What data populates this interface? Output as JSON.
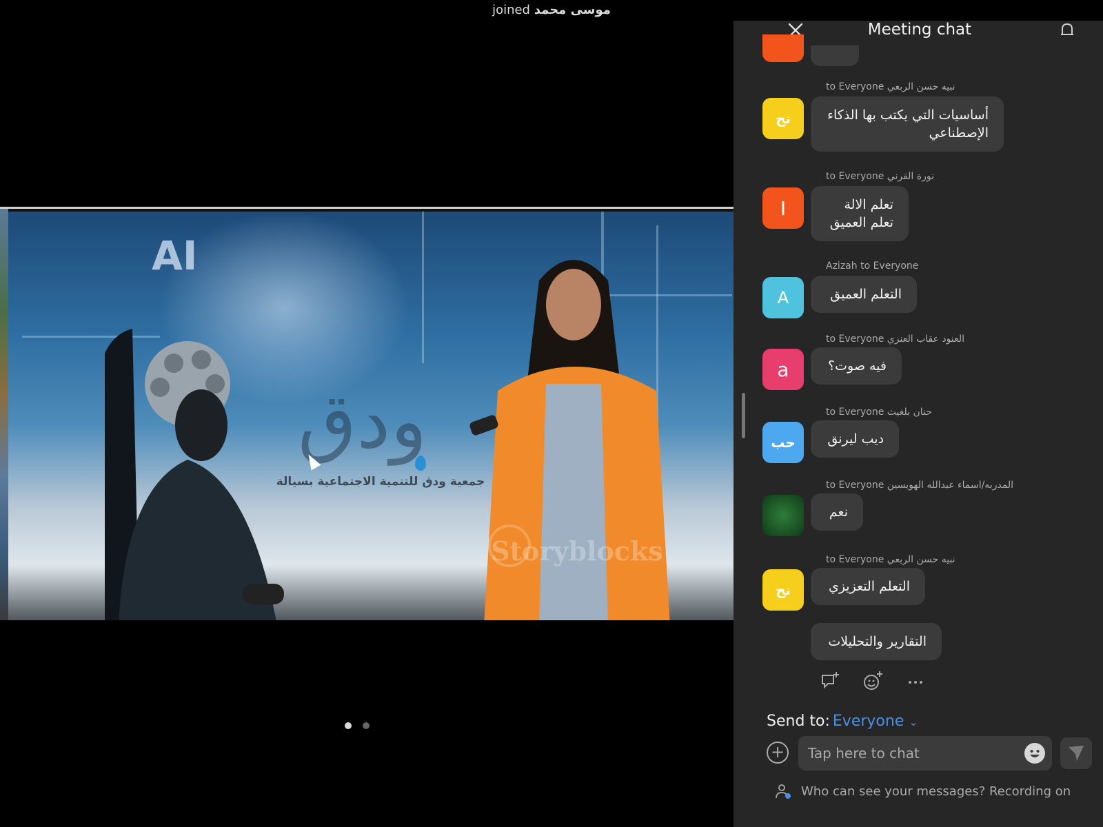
{
  "notification": {
    "name": "موسى محمد",
    "action": "joined"
  },
  "shared_screen": {
    "ai_text": "AI",
    "logo_text": "ودق",
    "logo_caption": "جمعية ودق للتنمية الاجتماعية بسيالة",
    "watermark": "Storyblocks"
  },
  "pager": {
    "count": 2,
    "active": 0
  },
  "chat": {
    "title": "Meeting chat",
    "messages": [
      {
        "sender": "نبيه حسن الربعي",
        "meta_suffix": "to Everyone",
        "avatar_text": "نح",
        "avatar_color": "#f6cf1d",
        "text": "أساسيات التي يكتب بها الذكاء الإصطناعي"
      },
      {
        "sender": "نورة القرني",
        "meta_suffix": "to Everyone",
        "avatar_text": "I",
        "avatar_color": "#f2541b",
        "text": "تعلم الالة تعلم العميق"
      },
      {
        "sender": "Azizah",
        "meta_suffix": "to Everyone",
        "avatar_text": "A",
        "avatar_color": "#4fc3dd",
        "text": "التعلم العميق"
      },
      {
        "sender": "العنود عقاب العنزي",
        "meta_suffix": "to Everyone",
        "avatar_text": "a",
        "avatar_color": "#e83e6e",
        "text": "فيه صوت؟"
      },
      {
        "sender": "حنان بلغيث",
        "meta_suffix": "to Everyone",
        "avatar_text": "حب",
        "avatar_color": "#4ea8f0",
        "text": "ديب ليرنق"
      },
      {
        "sender": "المدربه/اسماء عبدالله الهويسين",
        "meta_suffix": "to Everyone",
        "avatar_text": "",
        "avatar_color": "#1c5a2a",
        "text": "نعم"
      },
      {
        "sender": "نبيه حسن الربعي",
        "meta_suffix": "to Everyone",
        "avatar_text": "نح",
        "avatar_color": "#f6cf1d",
        "text": "التعلم التعزيزي"
      },
      {
        "text": "التقارير والتحليلات"
      }
    ],
    "send_to_label": "Send to:",
    "send_to_target": "Everyone",
    "input_placeholder": "Tap here to chat",
    "privacy_text": "Who can see your messages? Recording on"
  }
}
